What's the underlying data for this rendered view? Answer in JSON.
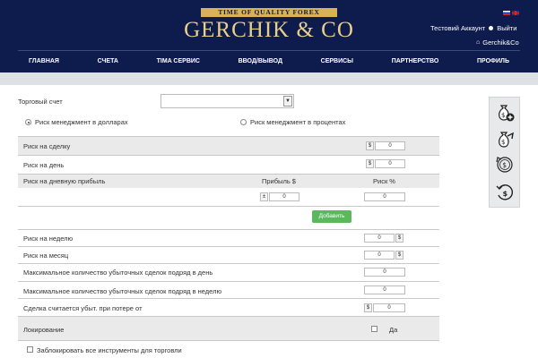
{
  "header": {
    "tagline": "TIME OF QUALITY FOREX",
    "logo": "GERCHIK & CO",
    "account_link": "Тестовий Аккаунт",
    "logout": "Выйти",
    "brand_link": "Gerchik&Co",
    "nav": [
      "ГЛАВНАЯ",
      "СЧЕТА",
      "TIMA СЕРВИС",
      "ВВОД/ВЫВОД",
      "СЕРВИСЫ",
      "ПАРТНЕРСТВО",
      "ПРОФИЛЬ"
    ]
  },
  "form": {
    "account_label": "Торговый счет",
    "account_value": "",
    "risk_dollars": "Риск менеджмент в долларах",
    "risk_percent": "Риск менеджмент в процентах",
    "risk_trade": "Риск на сделку",
    "risk_day": "Риск на день",
    "risk_daily_profit": "Риск на дневную прибыль",
    "profit_col": "Прибыль $",
    "risk_col": "Риск %",
    "add_button": "Добавить",
    "risk_week": "Риск на неделю",
    "risk_month": "Риск на месяц",
    "max_loss_day": "Максимальное количество убыточных сделок подряд в день",
    "max_loss_week": "Максимальное количество убыточных сделок подряд в неделю",
    "loss_trade": "Сделка считается убыт. при потере от",
    "locking": "Локирование",
    "yes": "Да",
    "block_all": "Заблокировать все инструменты для торговли",
    "zero": "0",
    "dollar": "$",
    "pm": "±"
  },
  "colors": {
    "header_bg": "#0e1b4d",
    "gold": "#d6b356",
    "add_button": "#5cb85c"
  },
  "sidebar_icons": [
    "money-bag-plus-icon",
    "money-bag-arrow-icon",
    "dollar-refresh-icon",
    "dollar-undo-icon"
  ]
}
